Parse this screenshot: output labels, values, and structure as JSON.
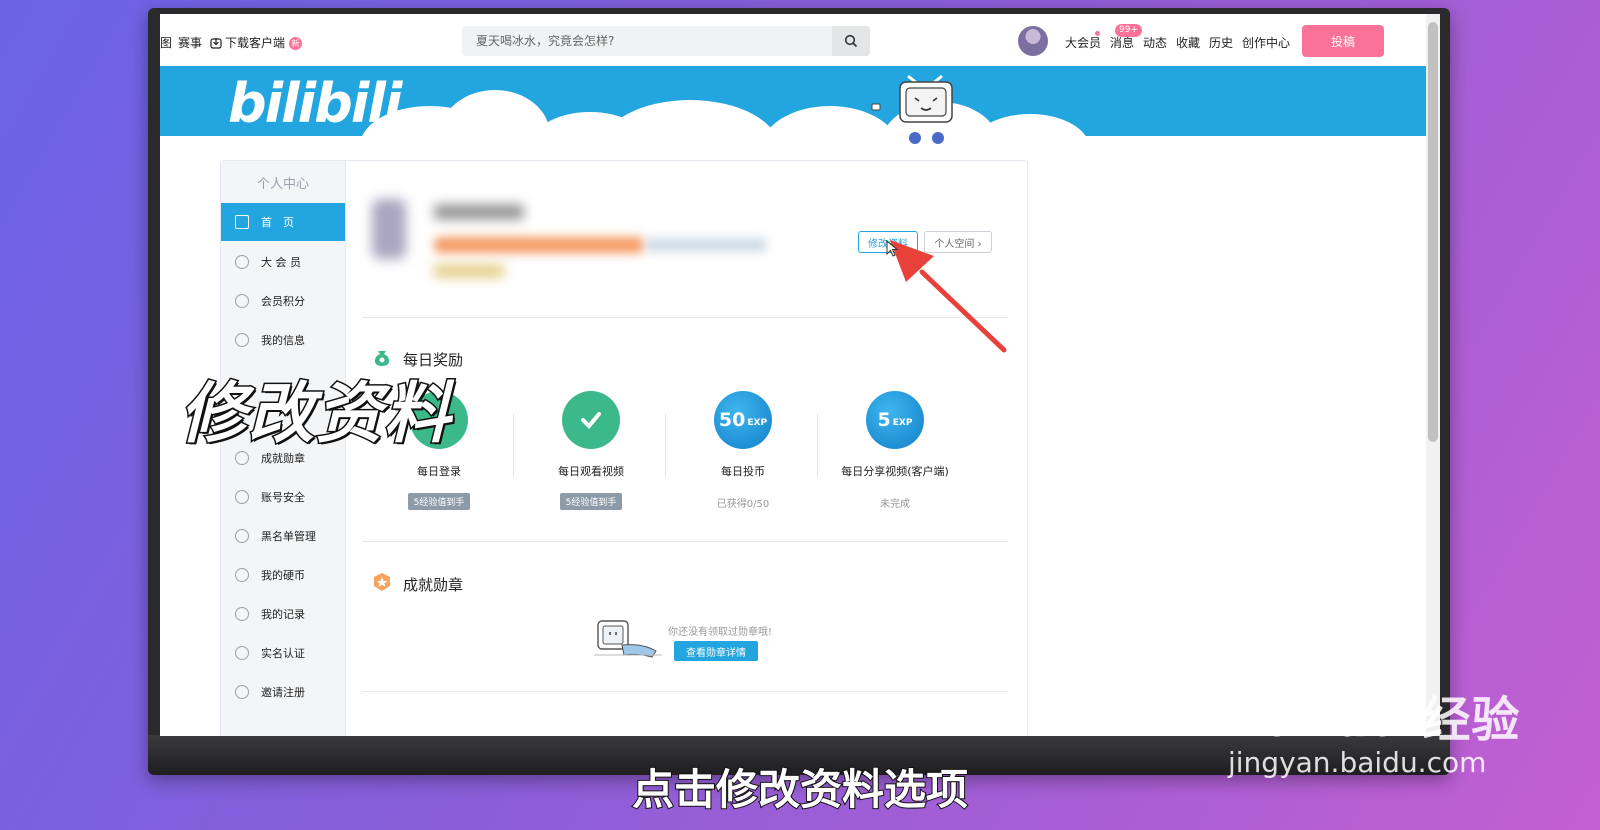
{
  "topnav": {
    "partial_left": "图",
    "events": "赛事",
    "download": "下载客户端",
    "download_badge": "新",
    "search_placeholder": "夏天喝冰水，究竟会怎样?",
    "vip": "大会员",
    "messages": "消息",
    "messages_badge": "99+",
    "dynamics": "动态",
    "favorites": "收藏",
    "history": "历史",
    "creator_center": "创作中心",
    "upload": "投稿"
  },
  "banner": {
    "logo": "bilibili"
  },
  "sidebar": {
    "title": "个人中心",
    "items": [
      {
        "label": "首　页",
        "active": true
      },
      {
        "label": "大 会 员"
      },
      {
        "label": "会员积分"
      },
      {
        "label": "我的信息"
      },
      {
        "label": "成就勋章"
      },
      {
        "label": "账号安全"
      },
      {
        "label": "黑名单管理"
      },
      {
        "label": "我的硬币"
      },
      {
        "label": "我的记录"
      },
      {
        "label": "实名认证"
      },
      {
        "label": "邀请注册"
      }
    ]
  },
  "profile": {
    "edit_button": "修改资料",
    "space_button": "个人空间 ›"
  },
  "daily_rewards": {
    "title": "每日奖励",
    "items": [
      {
        "label": "每日登录",
        "tag": "5经验值到手"
      },
      {
        "label": "每日观看视频",
        "tag": "5经验值到手"
      },
      {
        "label": "每日投币",
        "value": "50",
        "unit": "EXP",
        "status": "已获得0/50"
      },
      {
        "label": "每日分享视频(客户端)",
        "value": "5",
        "unit": "EXP",
        "status": "未完成"
      }
    ]
  },
  "medals": {
    "title": "成就勋章",
    "empty_text": "你还没有领取过勋章哦!",
    "button": "查看勋章详情"
  },
  "overlay": {
    "title": "修改资料",
    "caption": "点击修改资料选项",
    "watermark_main": "Bai du 经验",
    "watermark_sub": "jingyan.baidu.com"
  },
  "colors": {
    "accent": "#23a5e0",
    "pink": "#fb7299",
    "green": "#3cb98a",
    "arrow": "#e8413a"
  }
}
